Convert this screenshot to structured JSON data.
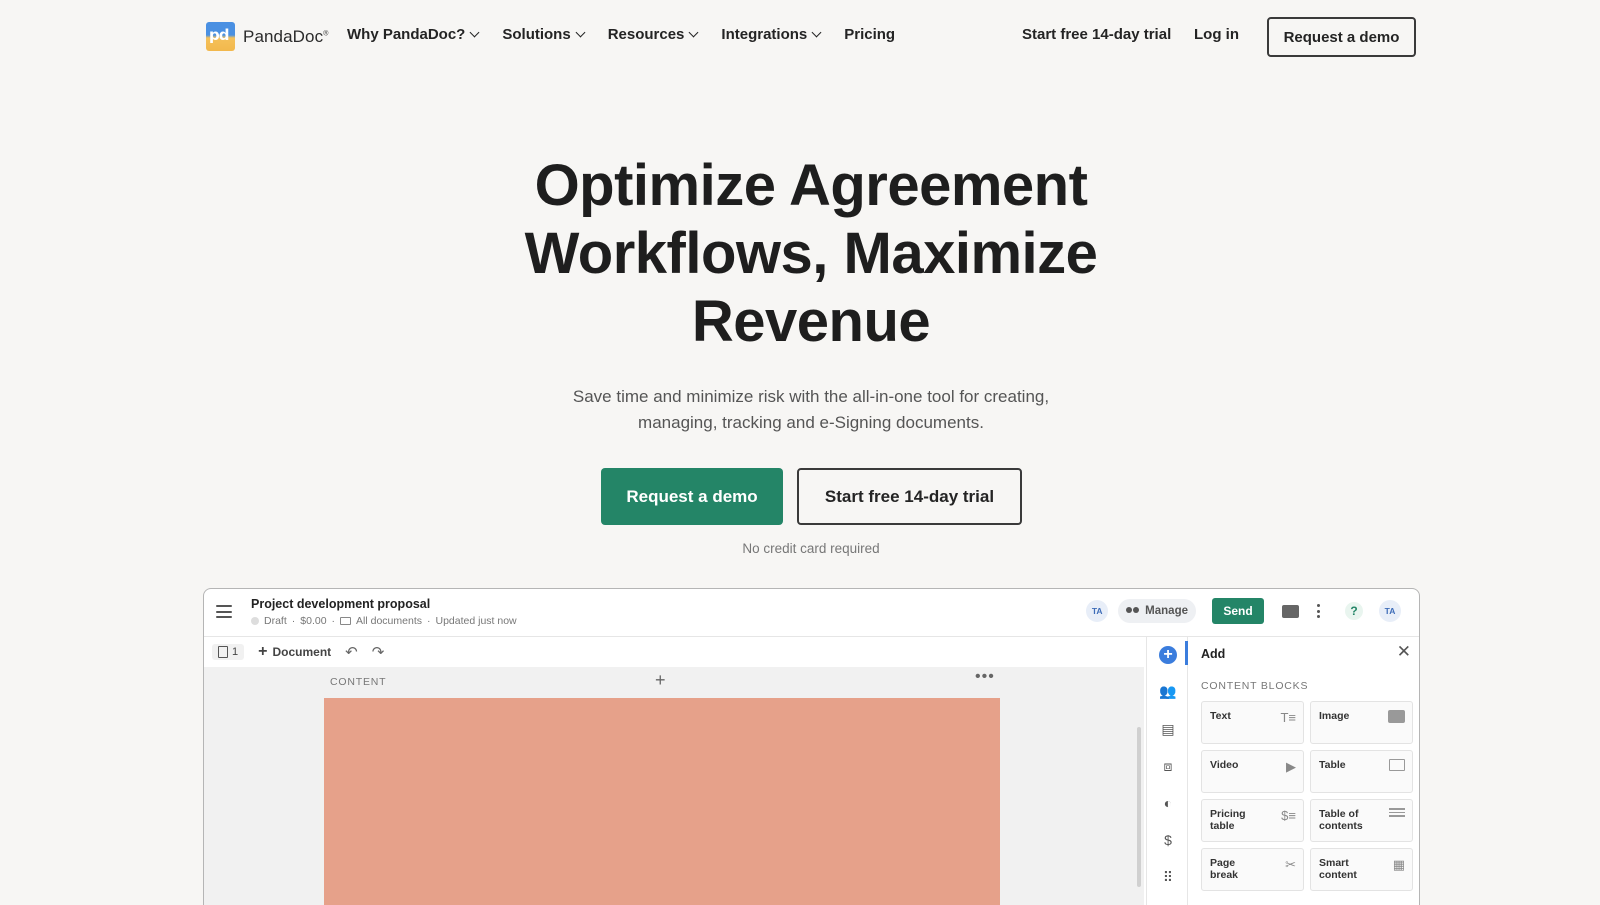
{
  "brand": {
    "name": "PandaDoc",
    "mark": "pd",
    "reg": "®",
    "colors": {
      "primary": "#248567",
      "text": "#242424",
      "background": "#f7f6f4"
    }
  },
  "nav": {
    "menu": [
      {
        "label": "Why PandaDoc?",
        "has_dropdown": true
      },
      {
        "label": "Solutions",
        "has_dropdown": true
      },
      {
        "label": "Resources",
        "has_dropdown": true
      },
      {
        "label": "Integrations",
        "has_dropdown": true
      },
      {
        "label": "Pricing",
        "has_dropdown": false
      }
    ],
    "trial_link": "Start free 14-day trial",
    "login_link": "Log in",
    "demo_button": "Request a demo"
  },
  "hero": {
    "title_line1": "Optimize Agreement",
    "title_line2": "Workflows, Maximize",
    "title_line3": "Revenue",
    "subtitle_line1": "Save time and minimize risk with the all-in-one tool for creating,",
    "subtitle_line2": "managing, tracking and e-Signing documents.",
    "primary_cta": "Request a demo",
    "secondary_cta": "Start free 14-day trial",
    "note": "No credit card required"
  },
  "app": {
    "doc_title": "Project development proposal",
    "status": "Draft",
    "amount": "$0.00",
    "folder": "All documents",
    "updated": "Updated just now",
    "avatar_initials": "TA",
    "manage_label": "Manage",
    "send_label": "Send",
    "help_label": "?",
    "page_count": "1",
    "add_document": "Document",
    "content_label": "CONTENT",
    "panel": {
      "title": "Add",
      "section": "CONTENT BLOCKS",
      "blocks": [
        {
          "label": "Text",
          "icon": "text-icon"
        },
        {
          "label": "Image",
          "icon": "image-icon"
        },
        {
          "label": "Video",
          "icon": "video-icon"
        },
        {
          "label": "Table",
          "icon": "table-icon"
        },
        {
          "label": "Pricing table",
          "icon": "pricing-icon"
        },
        {
          "label": "Table of contents",
          "icon": "toc-icon"
        },
        {
          "label": "Page break",
          "icon": "scissors-icon"
        },
        {
          "label": "Smart content",
          "icon": "smart-icon"
        }
      ]
    }
  }
}
